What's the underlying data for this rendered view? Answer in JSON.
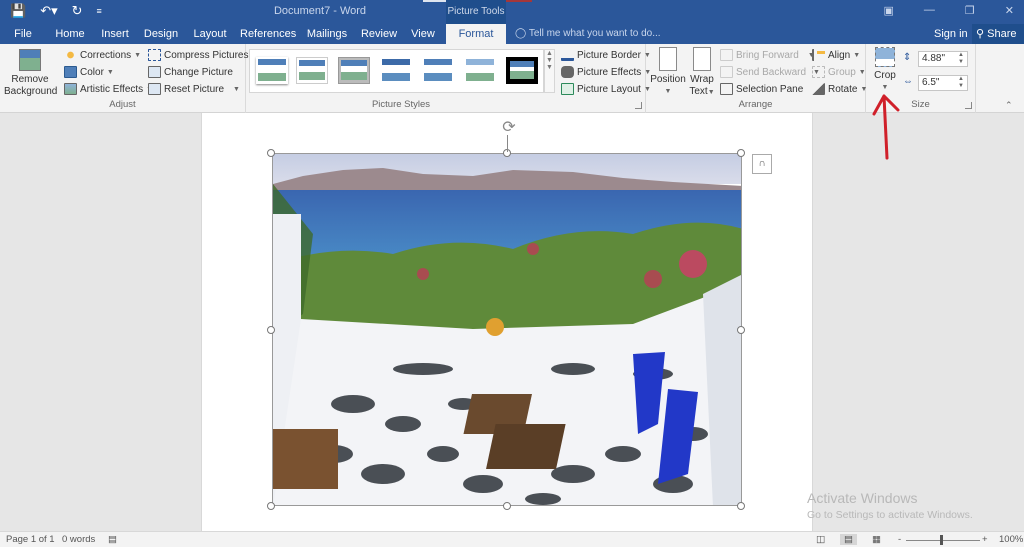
{
  "titlebar": {
    "doc_title": "Document7 - Word",
    "context_group": "Picture Tools",
    "qat": {
      "save_icon": "save-icon",
      "undo_icon": "undo-icon",
      "redo_icon": "redo-icon",
      "customize_icon": "customize-qat-icon"
    },
    "window_controls": [
      "ribbon-display-options",
      "minimize",
      "restore",
      "close"
    ]
  },
  "tabs": [
    {
      "label": "File"
    },
    {
      "label": "Home"
    },
    {
      "label": "Insert"
    },
    {
      "label": "Design"
    },
    {
      "label": "Layout"
    },
    {
      "label": "References"
    },
    {
      "label": "Mailings"
    },
    {
      "label": "Review"
    },
    {
      "label": "View"
    },
    {
      "label": "Format",
      "active": true
    }
  ],
  "tellme": {
    "placeholder": "Tell me what you want to do..."
  },
  "account": {
    "signin": "Sign in",
    "share": "Share"
  },
  "ribbon": {
    "adjust": {
      "label": "Adjust",
      "remove_background_1": "Remove",
      "remove_background_2": "Background",
      "corrections": "Corrections",
      "color": "Color",
      "artistic_effects": "Artistic Effects",
      "compress_pictures": "Compress Pictures",
      "change_picture": "Change Picture",
      "reset_picture": "Reset Picture"
    },
    "picture_styles": {
      "label": "Picture Styles",
      "styles_count": 7,
      "picture_border": "Picture Border",
      "picture_effects": "Picture Effects",
      "picture_layout": "Picture Layout"
    },
    "arrange": {
      "label": "Arrange",
      "position": "Position",
      "wrap_text_1": "Wrap",
      "wrap_text_2": "Text",
      "bring_forward": "Bring Forward",
      "send_backward": "Send Backward",
      "selection_pane": "Selection Pane",
      "align": "Align",
      "group": "Group",
      "rotate": "Rotate"
    },
    "size": {
      "label": "Size",
      "crop": "Crop",
      "height": "4.88\"",
      "width": "6.5\""
    }
  },
  "document": {
    "picture_description": "Whitewashed terrace with stone-patterned floor, wooden deck chairs with blue towels, overlooking the sea and an island"
  },
  "watermark": {
    "line1": "Activate Windows",
    "line2": "Go to Settings to activate Windows."
  },
  "statusbar": {
    "page": "Page 1 of 1",
    "words": "0 words",
    "zoom": "100%",
    "zoom_minus": "-",
    "zoom_plus": "+"
  },
  "colors": {
    "brand": "#2b579a",
    "context_tab": "#1f4e8c",
    "annotation": "#d0202a"
  }
}
